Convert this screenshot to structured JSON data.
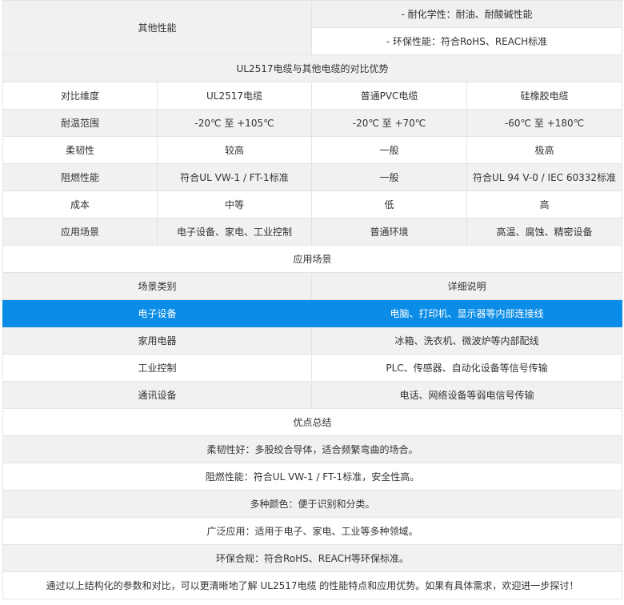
{
  "props": {
    "label": "其他性能",
    "items": [
      "- 耐化学性：耐油、耐酸碱性能",
      "- 环保性能：符合RoHS、REACH标准"
    ]
  },
  "comparison": {
    "title": "UL2517电缆与其他电缆的对比优势",
    "header": [
      "对比维度",
      "UL2517电缆",
      "普通PVC电缆",
      "硅橡胶电缆"
    ],
    "rows": [
      [
        "耐温范围",
        "-20℃ 至 +105℃",
        "-20℃ 至 +70℃",
        "-60℃ 至 +180℃"
      ],
      [
        "柔韧性",
        "较高",
        "一般",
        "极高"
      ],
      [
        "阻燃性能",
        "符合UL VW-1 / FT-1标准",
        "一般",
        "符合UL 94 V-0 / IEC 60332标准"
      ],
      [
        "成本",
        "中等",
        "低",
        "高"
      ],
      [
        "应用场景",
        "电子设备、家电、工业控制",
        "普通环境",
        "高温、腐蚀、精密设备"
      ]
    ]
  },
  "applications": {
    "title": "应用场景",
    "header": [
      "场景类别",
      "详细说明"
    ],
    "rows": [
      [
        "电子设备",
        "电脑、打印机、显示器等内部连接线"
      ],
      [
        "家用电器",
        "冰箱、洗衣机、微波炉等内部配线"
      ],
      [
        "工业控制",
        "PLC、传感器、自动化设备等信号传输"
      ],
      [
        "通讯设备",
        "电话、网络设备等弱电信号传输"
      ]
    ]
  },
  "advantages": {
    "title": "优点总结",
    "items": [
      "柔韧性好：多股绞合导体，适合频繁弯曲的场合。",
      "阻燃性能：符合UL VW-1 / FT-1标准，安全性高。",
      "多种颜色：便于识别和分类。",
      "广泛应用：适用于电子、家电、工业等多种领域。",
      "环保合规：符合RoHS、REACH等环保标准。"
    ]
  },
  "conclusion": "通过以上结构化的参数和对比，可以更清晰地了解 UL2517电缆 的性能特点和应用优势。如果有具体需求，欢迎进一步探讨！"
}
